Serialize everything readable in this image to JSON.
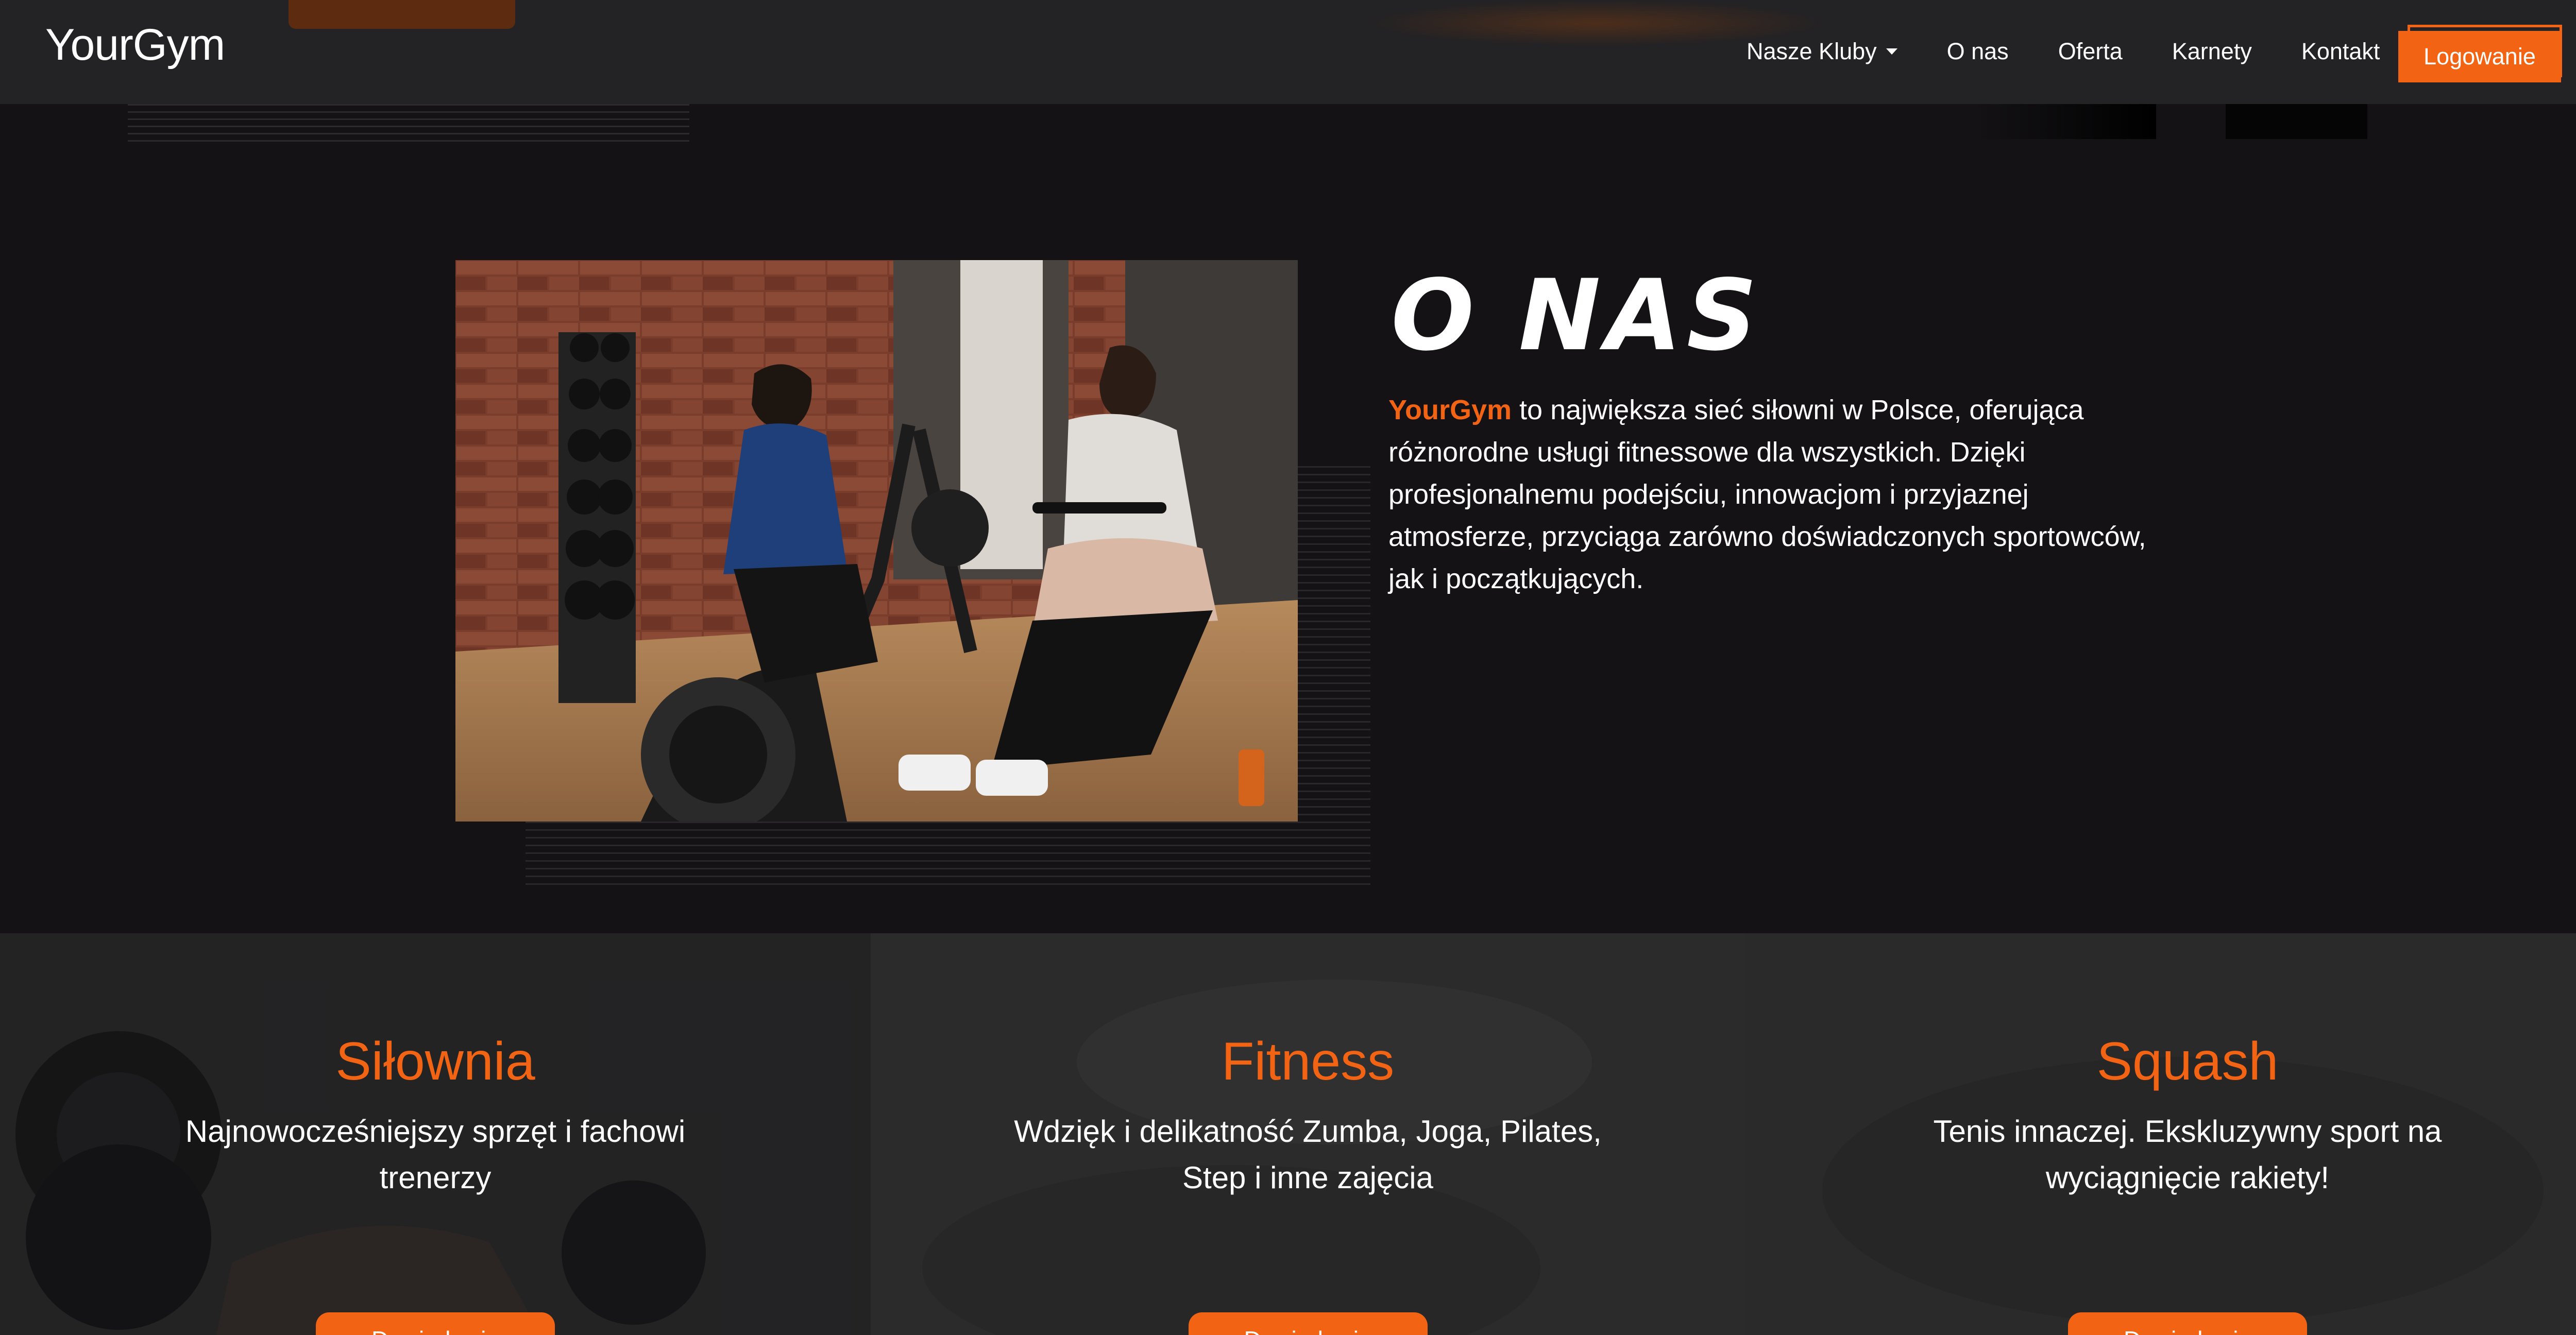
{
  "nav": {
    "brand": "YourGym",
    "links": [
      {
        "label": "Nasze Kluby",
        "dropdown": true
      },
      {
        "label": "O nas"
      },
      {
        "label": "Oferta"
      },
      {
        "label": "Karnety"
      },
      {
        "label": "Kontakt"
      }
    ],
    "login_label": "Logowanie"
  },
  "about": {
    "title": "O NAS",
    "brand_highlight": "YourGym",
    "text": " to największa sieć siłowni w Polsce, oferująca różnorodne usługi fitnessowe dla wszystkich. Dzięki profesjonalnemu podejściu, innowacjom i przyjaznej atmosferze, przyciąga zarówno doświadczonych sportowców, jak i początkujących."
  },
  "services": [
    {
      "title": "Siłownia",
      "description": "Najnowocześniejszy sprzęt i fachowi trenerzy",
      "button_label": "Dowiedz się"
    },
    {
      "title": "Fitness",
      "description": "Wdzięk i delikatność Zumba, Joga, Pilates, Step i inne zajęcia",
      "button_label": "Dowiedz się"
    },
    {
      "title": "Squash",
      "description": "Tenis innaczej. Ekskluzywny sport na wyciągnięcie rakiety!",
      "button_label": "Dowiedz się"
    }
  ],
  "colors": {
    "accent": "#f26414",
    "background": "#141215",
    "navbar": "#232224"
  }
}
